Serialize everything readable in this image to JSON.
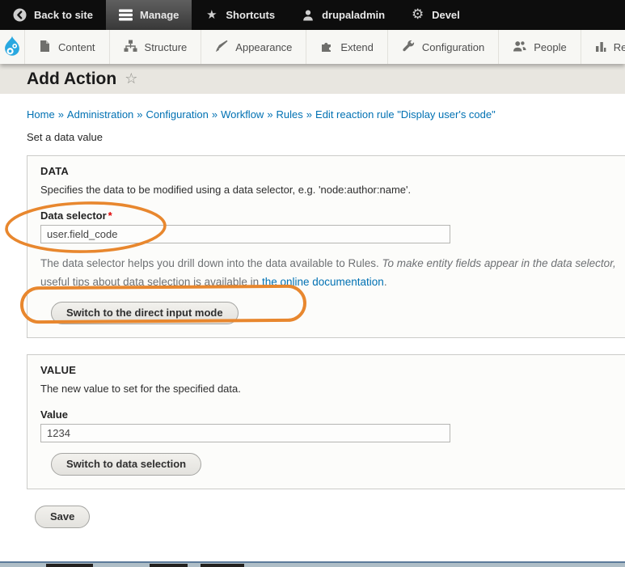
{
  "admin_toolbar": {
    "items": [
      {
        "label": "Back to site",
        "icon": "back-icon"
      },
      {
        "label": "Manage",
        "icon": "menu-icon",
        "active": true
      },
      {
        "label": "Shortcuts",
        "icon": "star-icon"
      },
      {
        "label": "drupaladmin",
        "icon": "user-icon"
      },
      {
        "label": "Devel",
        "icon": "gear-icon"
      }
    ],
    "star_glyph": "★",
    "gear_glyph": "⚙"
  },
  "menu_bar": {
    "items": [
      {
        "label": "Content",
        "icon": "document-icon"
      },
      {
        "label": "Structure",
        "icon": "sitemap-icon"
      },
      {
        "label": "Appearance",
        "icon": "paintbrush-icon"
      },
      {
        "label": "Extend",
        "icon": "puzzle-icon"
      },
      {
        "label": "Configuration",
        "icon": "wrench-icon"
      },
      {
        "label": "People",
        "icon": "people-icon"
      },
      {
        "label": "Reports",
        "icon": "barchart-icon"
      }
    ]
  },
  "page": {
    "title": "Add Action",
    "favorite_star_glyph": "☆"
  },
  "breadcrumb": {
    "separator": "»",
    "items": [
      "Home",
      "Administration",
      "Configuration",
      "Workflow",
      "Rules",
      "Edit reaction rule \"Display user's code\""
    ]
  },
  "intro_text": "Set a data value",
  "data_fieldset": {
    "legend": "DATA",
    "description": "Specifies the data to be modified using a data selector, e.g. 'node:author:name'.",
    "field_label": "Data selector",
    "required_marker": "*",
    "input_value": "user.field_code",
    "help_line1_normal": "The data selector helps you drill down into the data available to Rules. ",
    "help_line1_italic": "To make entity fields appear in the data selector,",
    "help_line2_prefix": "useful tips about data selection is available in ",
    "help_link_text": "the online documentation",
    "help_line2_suffix": ".",
    "switch_button": "Switch to the direct input mode"
  },
  "value_fieldset": {
    "legend": "VALUE",
    "description": "The new value to set for the specified data.",
    "field_label": "Value",
    "input_value": "1234",
    "switch_button": "Switch to data selection"
  },
  "actions": {
    "save_label": "Save"
  },
  "colors": {
    "annotation_orange": "#e8872e",
    "link_blue": "#0071b3",
    "drupal_logo_blue": "#29a8e0",
    "toolbar_black": "#0d0d0d",
    "required_red": "#e00202"
  }
}
